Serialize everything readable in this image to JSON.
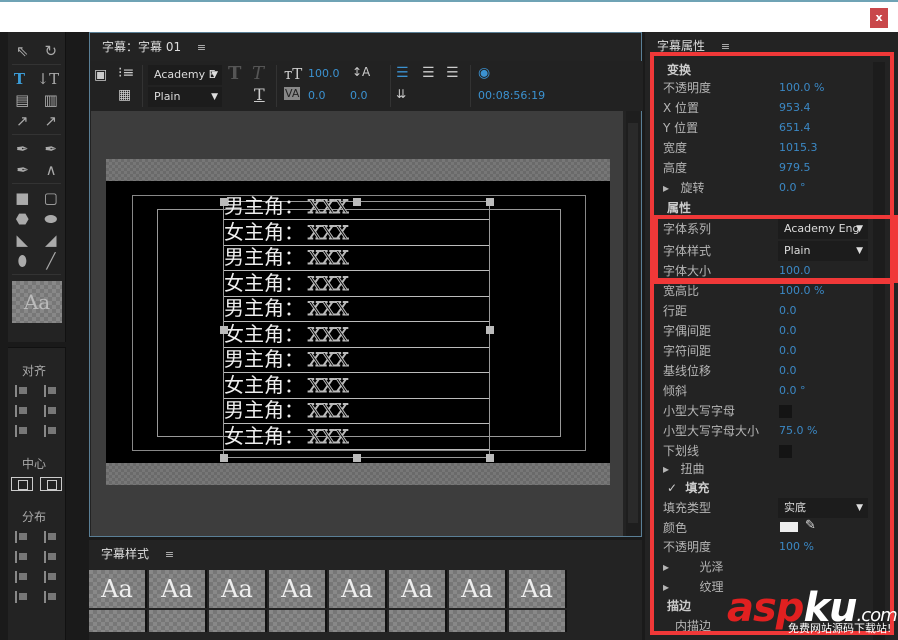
{
  "window": {
    "close_label": "x"
  },
  "main_panel": {
    "title": "字幕：字幕 01",
    "menu_icon": "≡",
    "font_family": "Academy E",
    "font_style": "Plain",
    "font_size": "100.0",
    "kerning": "0.0",
    "leading": "0.0",
    "timecode": "00:08:56:19"
  },
  "title_lines": [
    {
      "label": "男主角：",
      "value": "XXX"
    },
    {
      "label": "女主角：",
      "value": "XXX"
    },
    {
      "label": "男主角：",
      "value": "XXX"
    },
    {
      "label": "女主角：",
      "value": "XXX"
    },
    {
      "label": "男主角：",
      "value": "XXX"
    },
    {
      "label": "女主角：",
      "value": "XXX"
    },
    {
      "label": "男主角：",
      "value": "XXX"
    },
    {
      "label": "女主角：",
      "value": "XXX"
    },
    {
      "label": "男主角：",
      "value": "XXX"
    },
    {
      "label": "女主角：",
      "value": "XXX"
    }
  ],
  "align_panel": {
    "align": "对齐",
    "center": "中心",
    "distribute": "分布"
  },
  "tools": {
    "preview": "Aa"
  },
  "styles_panel": {
    "title": "字幕样式",
    "menu_icon": "≡",
    "swatch": "Aa"
  },
  "properties": {
    "title": "字幕属性",
    "menu_icon": "≡",
    "transform": "变换",
    "opacity_label": "不透明度",
    "opacity": "100.0 %",
    "x_label": "X 位置",
    "x": "953.4",
    "y_label": "Y 位置",
    "y": "651.4",
    "width_label": "宽度",
    "width": "1015.3",
    "height_label": "高度",
    "height": "979.5",
    "rotation_label": "旋转",
    "rotation": "0.0 °",
    "attributes": "属性",
    "font_family_label": "字体系列",
    "font_family": "Academy Eng",
    "font_style_label": "字体样式",
    "font_style": "Plain",
    "font_size_label": "字体大小",
    "font_size": "100.0",
    "aspect_label": "宽高比",
    "aspect": "100.0 %",
    "leading_label": "行距",
    "leading": "0.0",
    "kerning_label": "字偶间距",
    "kerning": "0.0",
    "tracking_label": "字符间距",
    "tracking": "0.0",
    "baseline_label": "基线位移",
    "baseline": "0.0",
    "slant_label": "倾斜",
    "slant": "0.0 °",
    "smallcaps_label": "小型大写字母",
    "smallcaps_size_label": "小型大写字母大小",
    "smallcaps_size": "75.0 %",
    "underline_label": "下划线",
    "distort_label": "扭曲",
    "fill": "填充",
    "fill_type_label": "填充类型",
    "fill_type": "实底",
    "color_label": "颜色",
    "fill_opacity_label": "不透明度",
    "fill_opacity": "100 %",
    "sheen_label": "光泽",
    "texture_label": "纹理",
    "stroke": "描边",
    "inner_stroke": "内描边"
  },
  "watermark": {
    "a": "asp",
    "b": "ku",
    "c": ".com",
    "sub": "免费网站源码下载站!"
  },
  "colors": {
    "accent": "#3b88c4",
    "highlight_box": "#f03838",
    "panel_bg": "#232323"
  }
}
